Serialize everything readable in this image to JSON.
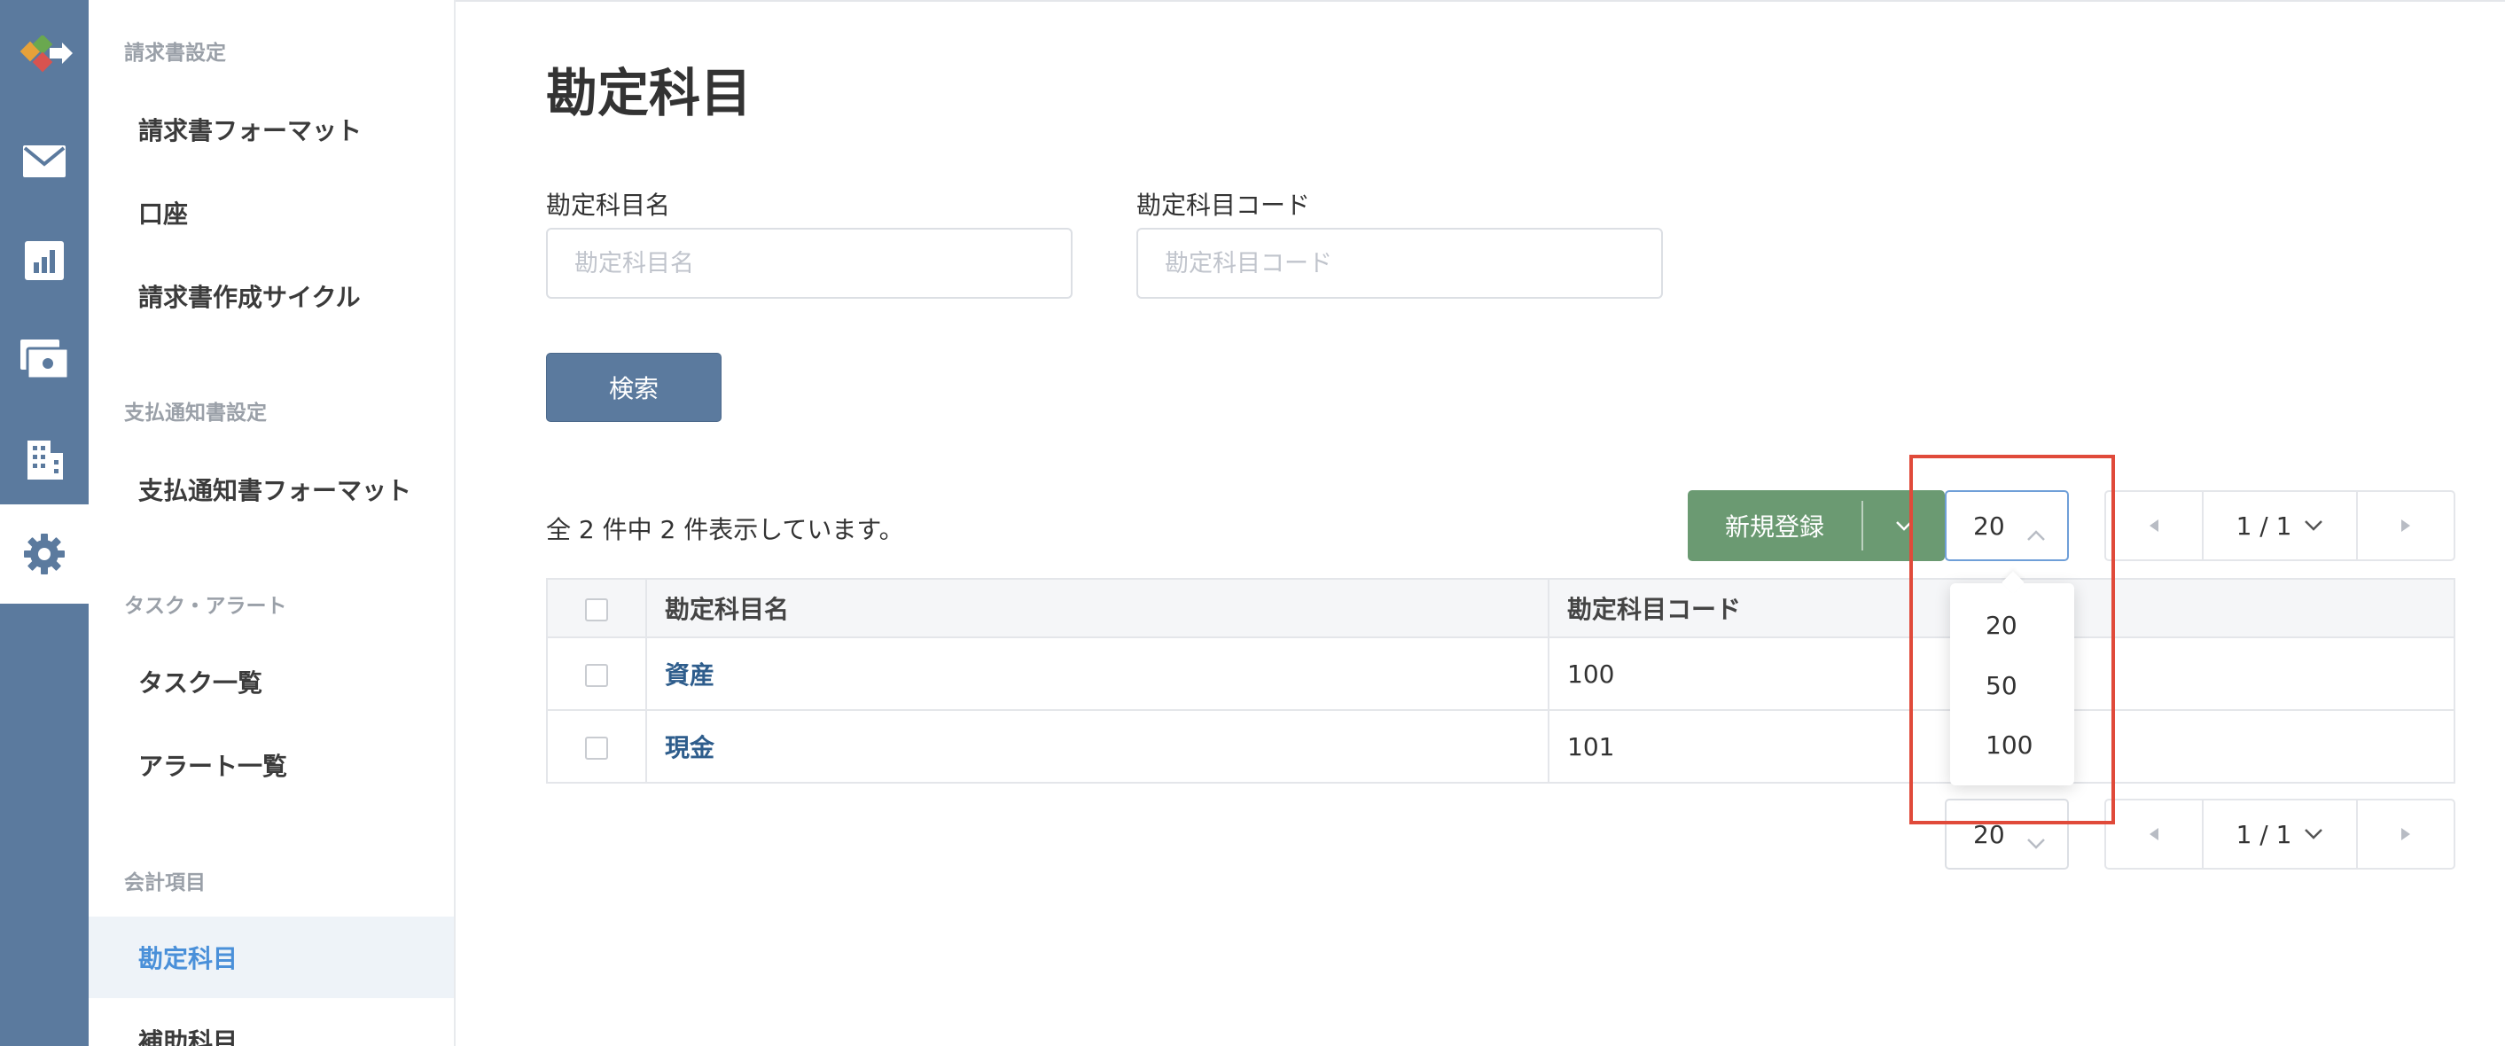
{
  "rail": {
    "items": [
      {
        "icon": "app-logo-icon"
      },
      {
        "icon": "mail-icon"
      },
      {
        "icon": "chart-icon"
      },
      {
        "icon": "money-icon"
      },
      {
        "icon": "building-icon"
      },
      {
        "icon": "gear-icon",
        "active": true
      }
    ]
  },
  "sidebar": {
    "sections": [
      {
        "title": "請求書設定",
        "items": [
          "請求書フォーマット",
          "口座",
          "請求書作成サイクル"
        ]
      },
      {
        "title": "支払通知書設定",
        "items": [
          "支払通知書フォーマット"
        ]
      },
      {
        "title": "タスク・アラート",
        "items": [
          "タスク一覧",
          "アラート一覧"
        ]
      },
      {
        "title": "会計項目",
        "items": [
          "勘定科目",
          "補助科目"
        ]
      }
    ],
    "active_item": "勘定科目"
  },
  "main": {
    "title": "勘定科目",
    "filters": {
      "name_label": "勘定科目名",
      "name_placeholder": "勘定科目名",
      "name_value": "",
      "code_label": "勘定科目コード",
      "code_placeholder": "勘定科目コード",
      "code_value": ""
    },
    "search_label": "検索",
    "result_count": "全 2 件中 2 件表示しています。",
    "new_button_label": "新規登録",
    "page_size": {
      "value": "20",
      "options": [
        "20",
        "50",
        "100"
      ],
      "open": true
    },
    "pagination": {
      "current": "1 / 1"
    },
    "table": {
      "headers": [
        "勘定科目名",
        "勘定科目コード"
      ],
      "rows": [
        {
          "name": "資産",
          "code": "100"
        },
        {
          "name": "現金",
          "code": "101"
        }
      ]
    }
  },
  "colors": {
    "rail": "#5b7a9e",
    "search_button": "#5b7a9e",
    "new_button": "#6b9a72",
    "active_link": "#4a90d9",
    "highlight": "#e04a3a"
  }
}
